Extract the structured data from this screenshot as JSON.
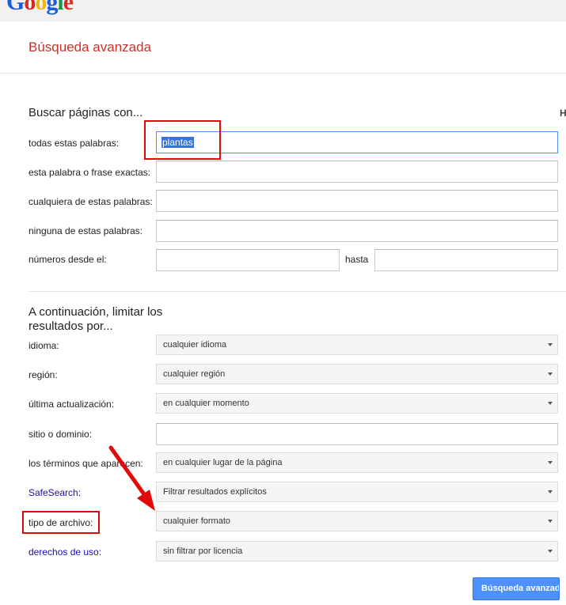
{
  "logo_text": [
    "G",
    "o",
    "o",
    "g",
    "l",
    "e"
  ],
  "page_title": "Búsqueda avanzada",
  "section1": {
    "title": "Buscar páginas con...",
    "edge_text": "H",
    "fields": {
      "all_words": {
        "label": "todas estas palabras:",
        "value": "plantas"
      },
      "exact_phrase": {
        "label": "esta palabra o frase exactas:",
        "value": ""
      },
      "any_words": {
        "label": "cualquiera de estas palabras:",
        "value": ""
      },
      "none_words": {
        "label": "ninguna de estas palabras:",
        "value": ""
      },
      "numbers_from": {
        "label": "números desde el:",
        "value": ""
      },
      "numbers_to": {
        "label": "hasta",
        "value": ""
      }
    }
  },
  "section2": {
    "title_line1": "A continuación, limitar los",
    "title_line2": "resultados por...",
    "language": {
      "label": "idioma:",
      "value": "cualquier idioma"
    },
    "region": {
      "label": "región:",
      "value": "cualquier región"
    },
    "last_update": {
      "label": "última actualización:",
      "value": "en cualquier momento"
    },
    "site": {
      "label": "sitio o dominio:",
      "value": ""
    },
    "terms_appear": {
      "label": "los términos que aparecen:",
      "value": "en cualquier lugar de la página"
    },
    "safesearch": {
      "label": "SafeSearch:",
      "value": "Filtrar resultados explícitos"
    },
    "file_type": {
      "label": "tipo de archivo:",
      "value": "cualquier formato"
    },
    "usage_rights": {
      "label": "derechos de uso:",
      "value": "sin filtrar por licencia"
    }
  },
  "submit_label": "Búsqueda avanzada",
  "colors": {
    "title_red": "#c8322b",
    "link_blue": "#1a0dab",
    "button_blue": "#4d90fe",
    "annotation_red": "#e10a0a"
  }
}
